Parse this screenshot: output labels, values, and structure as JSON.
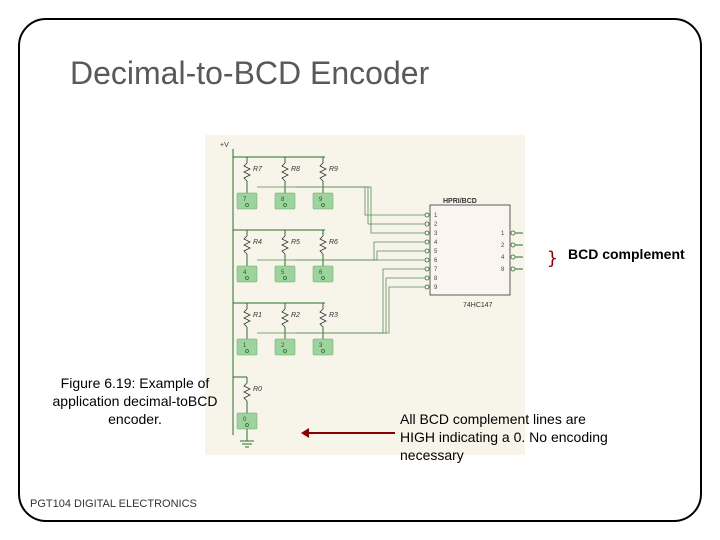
{
  "title": "Decimal-to-BCD Encoder",
  "diagram": {
    "supply": "+V",
    "resistors": [
      "R7",
      "R8",
      "R9",
      "R4",
      "R5",
      "R6",
      "R1",
      "R2",
      "R3",
      "R0"
    ],
    "switches": [
      "7",
      "8",
      "9",
      "4",
      "5",
      "6",
      "1",
      "2",
      "3",
      "0"
    ],
    "chip": {
      "name": "HPRI/BCD",
      "part": "74HC147",
      "left_pins": [
        "1",
        "2",
        "3",
        "4",
        "5",
        "6",
        "7",
        "8",
        "9"
      ],
      "right_pins": [
        "1",
        "2",
        "4",
        "8"
      ]
    }
  },
  "labels": {
    "bcd_complement": "BCD complement",
    "caption": "Figure 6.19: Example of application decimal-to­BCD encoder.",
    "annotation": "All BCD complement lines are HIGH indicating a 0. No encoding necessary"
  },
  "footer": "PGT104 DIGITAL ELECTRONICS"
}
